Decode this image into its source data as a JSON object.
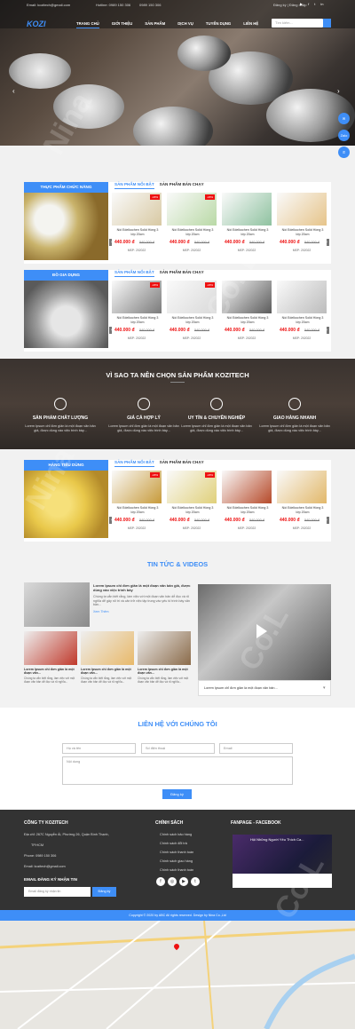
{
  "topbar": {
    "email": "Email: kozitech@gmail.com",
    "hotline_label": "Hotline: 0989 150 306",
    "hotline2": "0989 150 306",
    "login": "Đăng ký | Đăng nhập"
  },
  "logo": "KOZI",
  "nav": [
    "TRANG CHỦ",
    "GIỚI THIỆU",
    "SẢN PHẨM",
    "DỊCH VỤ",
    "TUYỂN DỤNG",
    "LIÊN HỆ"
  ],
  "search": {
    "placeholder": "Tìm kiếm..."
  },
  "fab": {
    "messenger": "Msg",
    "zalo": "Zalo",
    "phone": "Call"
  },
  "tabs": {
    "featured": "SẢN PHẨM NỔI BẬT",
    "best": "SẢN PHẨM BÁN CHẠY"
  },
  "categories": [
    {
      "title": "THỰC PHẨM CHỨC NĂNG"
    },
    {
      "title": "ĐỒ GIA DỤNG"
    },
    {
      "title": "HÀNG TIÊU DÙNG"
    }
  ],
  "product": {
    "name": "Nồi Edelkochen Solid Hồng 3 lớp 20cm",
    "price": "440.000 đ",
    "old_price": "540.000 đ",
    "msp": "MSP: 202022",
    "badge": "-18%"
  },
  "why": {
    "title": "VÌ SAO TA NÊN CHỌN SẢN PHẨM KOZITECH",
    "items": [
      {
        "title": "SẢN PHẨM CHẤT LƯỢNG",
        "desc": "Lorem Ipsum chỉ đơn giản là một đoạn văn bản giả, được dùng vào việc trình bày..."
      },
      {
        "title": "GIÁ CẢ HỢP LÝ",
        "desc": "Lorem Ipsum chỉ đơn giản là một đoạn văn bản giả, được dùng vào việc trình bày..."
      },
      {
        "title": "UY TÍN & CHUYÊN NGHIỆP",
        "desc": "Lorem Ipsum chỉ đơn giản là một đoạn văn bản giả, được dùng vào việc trình bày..."
      },
      {
        "title": "GIAO HÀNG NHANH",
        "desc": "Lorem Ipsum chỉ đơn giản là một đoạn văn bản giả, được dùng vào việc trình bày..."
      }
    ]
  },
  "news": {
    "title": "TIN TỨC & VIDEOS",
    "main_title": "Lorem Ipsum chỉ đơn giản là một đoạn văn bản giả, được dùng vào việc trình bày",
    "main_desc": "Chúng ta vẫn biết rằng, làm việc với một đoạn văn bản dễ đọc và rõ nghĩa dễ gây rối trí và cản trở việc tập trung vào yếu tố trình bày văn bản...",
    "more": "Xem Thêm",
    "item_title": "Lorem Ipsum chỉ đơn giản là một đoạn văn...",
    "item_desc": "Chúng ta vẫn biết rằng, làm việc với một đoạn văn bản dễ đọc và rõ nghĩa...",
    "video_caption": "Lorem Ipsum chỉ đơn giản là một đoạn văn bản..."
  },
  "contact": {
    "title": "LIÊN HỆ VỚI CHÚNG TÔI",
    "name": "Họ và tên",
    "phone": "Số điện thoại",
    "email": "Email",
    "content": "Nội dung",
    "submit": "Đăng ký"
  },
  "footer": {
    "company": "CÔNG TY KOZITECH",
    "address": "Địa chỉ: 267C Nguyễn Ái, Phường 26, Quận Bình Thạnh,",
    "city": "TP.HCM",
    "phone": "Phone: 0989 150 306",
    "email": "Email: kozitech@gmail.com",
    "newsletter": "EMAIL ĐĂNG KÝ NHẬN TIN",
    "newsletter_placeholder": "Email đăng ký nhận tin",
    "newsletter_btn": "Đăng ký",
    "policy_title": "CHÍNH SÁCH",
    "policies": [
      "Chính sách bảo hàng",
      "Chính sách đổi trả",
      "Chính sách thanh toán",
      "Chính sách giao hàng",
      "Chính sách thanh toán"
    ],
    "fanpage_title": "FANPAGE - FACEBOOK",
    "fanpage_name": "Hội Những Người Yêu Thích Ca..."
  },
  "copyright": "Copyright © 2020 by ABC All rights reserved. Design by Nina Co.,Ltd",
  "colors": {
    "accent": "#3e8ef7",
    "price": "#e11111",
    "footer": "#333333"
  }
}
